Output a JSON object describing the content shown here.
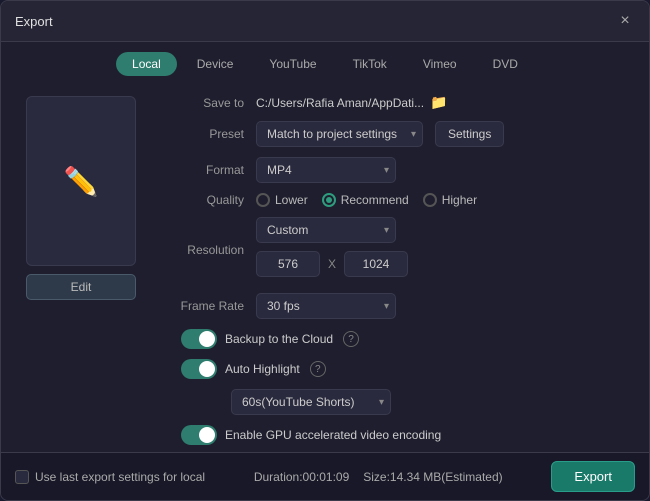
{
  "window": {
    "title": "Export",
    "close_label": "×"
  },
  "tabs": [
    {
      "id": "local",
      "label": "Local",
      "active": true
    },
    {
      "id": "device",
      "label": "Device",
      "active": false
    },
    {
      "id": "youtube",
      "label": "YouTube",
      "active": false
    },
    {
      "id": "tiktok",
      "label": "TikTok",
      "active": false
    },
    {
      "id": "vimeo",
      "label": "Vimeo",
      "active": false
    },
    {
      "id": "dvd",
      "label": "DVD",
      "active": false
    }
  ],
  "preview": {
    "edit_label": "Edit"
  },
  "fields": {
    "save_to_label": "Save to",
    "save_to_value": "C:/Users/Rafia Aman/AppDati...",
    "preset_label": "Preset",
    "preset_value": "Match to project settings",
    "settings_label": "Settings",
    "format_label": "Format",
    "format_value": "MP4",
    "quality_label": "Quality",
    "quality_lower": "Lower",
    "quality_recommend": "Recommend",
    "quality_higher": "Higher",
    "resolution_label": "Resolution",
    "resolution_value": "Custom",
    "resolution_w": "576",
    "resolution_x": "X",
    "resolution_h": "1024",
    "frame_rate_label": "Frame Rate",
    "frame_rate_value": "30 fps"
  },
  "toggles": {
    "cloud_label": "Backup to the Cloud",
    "highlight_label": "Auto Highlight",
    "highlight_dropdown": "60s(YouTube Shorts)",
    "gpu_label": "Enable GPU accelerated video encoding"
  },
  "footer": {
    "checkbox_label": "Use last export settings for local",
    "duration_label": "Duration:00:01:09",
    "size_label": "Size:14.34 MB(Estimated)",
    "export_label": "Export"
  }
}
